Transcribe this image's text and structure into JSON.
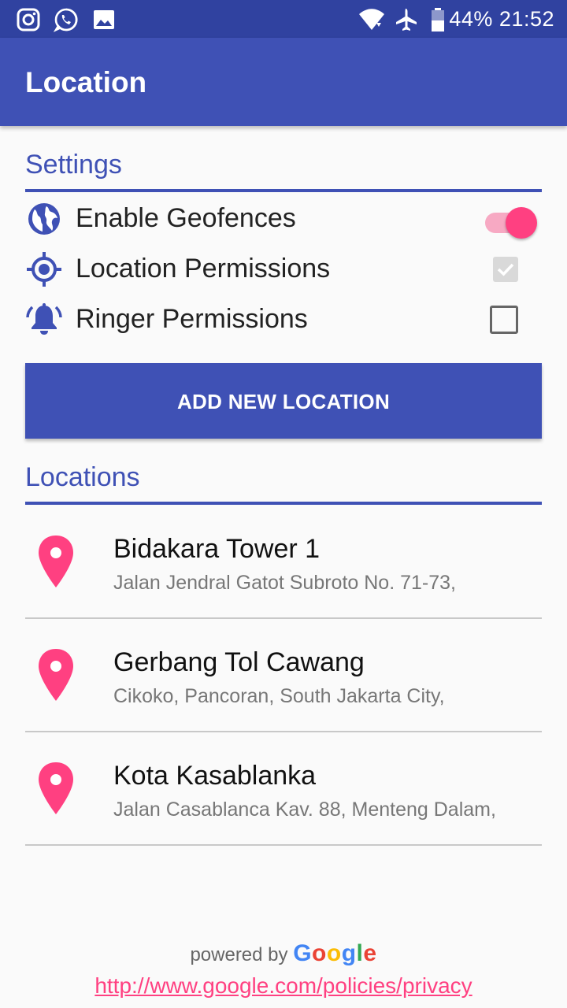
{
  "status_bar": {
    "battery": "44%",
    "time": "21:52",
    "left_icons": [
      "instagram-icon",
      "whatsapp-icon",
      "gallery-icon"
    ],
    "right_icons": [
      "wifi-icon",
      "airplane-icon",
      "battery-icon"
    ]
  },
  "toolbar": {
    "title": "Location"
  },
  "settings": {
    "title": "Settings",
    "items": [
      {
        "label": "Enable Geofences",
        "icon": "globe-icon",
        "control": "switch",
        "checked": true
      },
      {
        "label": "Location Permissions",
        "icon": "target-icon",
        "control": "checkbox",
        "checked": true
      },
      {
        "label": "Ringer Permissions",
        "icon": "bell-icon",
        "control": "checkbox",
        "checked": false
      }
    ]
  },
  "add_button": {
    "label": "ADD NEW LOCATION"
  },
  "locations": {
    "title": "Locations",
    "items": [
      {
        "name": "Bidakara Tower 1",
        "address": "Jalan Jendral Gatot Subroto No. 71-73,"
      },
      {
        "name": "Gerbang Tol Cawang",
        "address": "Cikoko, Pancoran, South Jakarta City,"
      },
      {
        "name": "Kota Kasablanka",
        "address": "Jalan Casablanca Kav. 88, Menteng Dalam,"
      }
    ]
  },
  "footer": {
    "powered_by": "powered by",
    "google": "Google",
    "privacy_link": "http://www.google.com/policies/privacy"
  },
  "colors": {
    "primary": "#3f51b5",
    "primary_dark": "#3042a0",
    "accent": "#ff4081"
  }
}
